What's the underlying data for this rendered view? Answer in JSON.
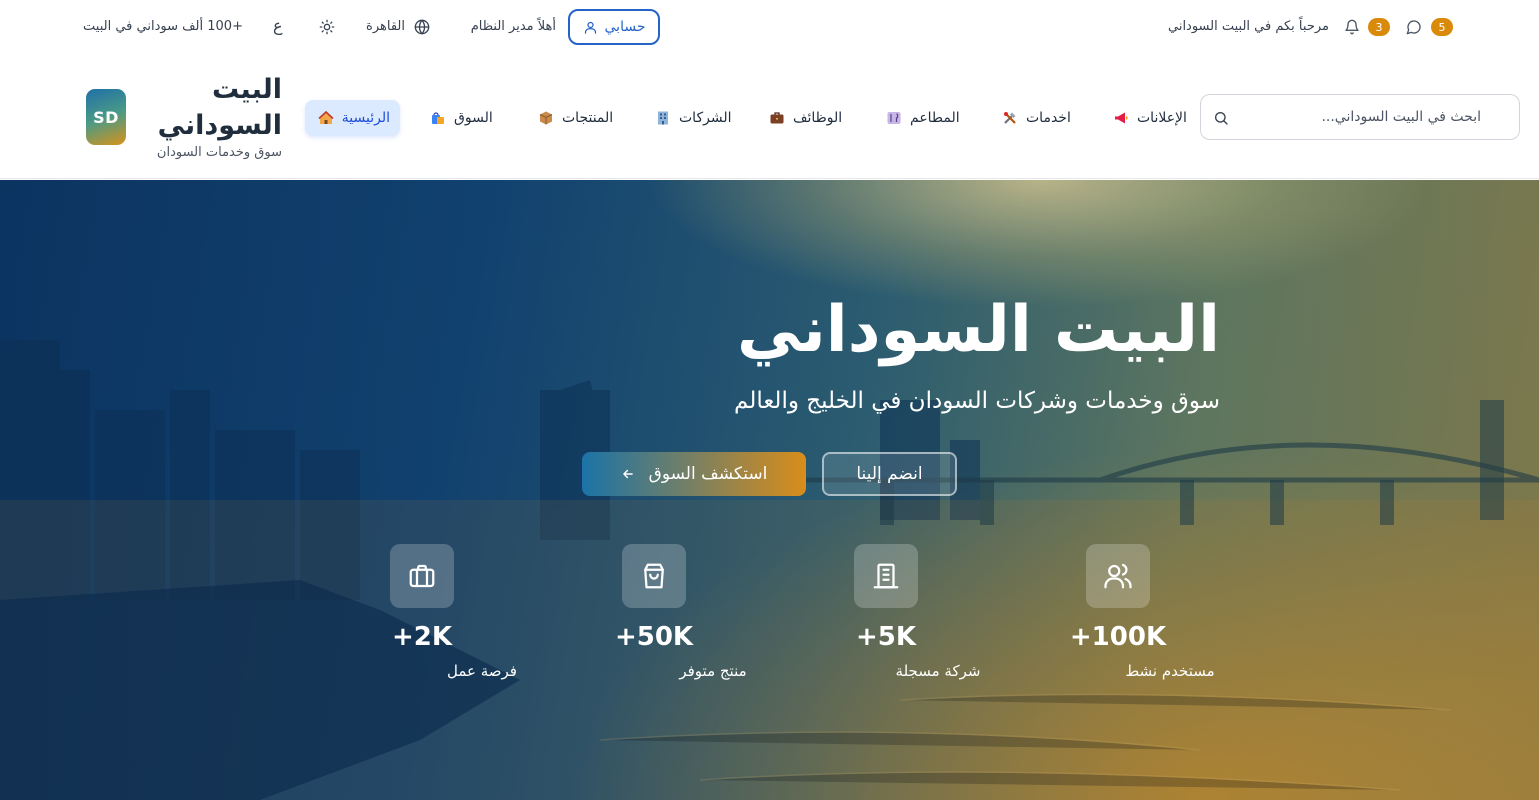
{
  "topbar": {
    "welcome": "مرحباً بكم في البيت السوداني",
    "notifications_count": "3",
    "messages_count": "5",
    "account_label": "حسابي",
    "greeting": "أهلاً مدير النظام",
    "location": "القاهرة",
    "language": "ع",
    "users_text": "+100 ألف سوداني في البيت"
  },
  "brand": {
    "logo_text": "SD",
    "title": "البيت السوداني",
    "subtitle": "سوق وخدمات السودان"
  },
  "nav": {
    "items": [
      {
        "label": "الرئيسية",
        "icon": "house-icon",
        "active": true
      },
      {
        "label": "السوق",
        "icon": "shopping-bags-icon"
      },
      {
        "label": "المنتجات",
        "icon": "package-icon"
      },
      {
        "label": "الشركات",
        "icon": "office-building-icon"
      },
      {
        "label": "الوظائف",
        "icon": "briefcase-icon"
      },
      {
        "label": "المطاعم",
        "icon": "restaurant-icon"
      },
      {
        "label": "اخدمات",
        "icon": "tools-icon"
      },
      {
        "label": "الإعلانات",
        "icon": "megaphone-icon"
      }
    ]
  },
  "search": {
    "placeholder": "ابحث في البيت السوداني..."
  },
  "hero": {
    "title": "البيت السوداني",
    "subtitle": "سوق وخدمات وشركات السودان في الخليج والعالم",
    "join_label": "انضم إلينا",
    "explore_label": "استكشف السوق"
  },
  "stats": [
    {
      "value": "+100K",
      "label": "مستخدم نشط",
      "icon": "users-icon"
    },
    {
      "value": "+5K",
      "label": "شركة مسجلة",
      "icon": "building-icon"
    },
    {
      "value": "+50K",
      "label": "منتج متوفر",
      "icon": "shopping-bag-icon"
    },
    {
      "value": "+2K",
      "label": "فرصة عمل",
      "icon": "briefcase-icon"
    }
  ],
  "colors": {
    "primary_blue": "#2563c9",
    "accent_orange": "#d98a0b",
    "gradient_start": "#1b73a8",
    "gradient_end": "#d98d1a"
  }
}
